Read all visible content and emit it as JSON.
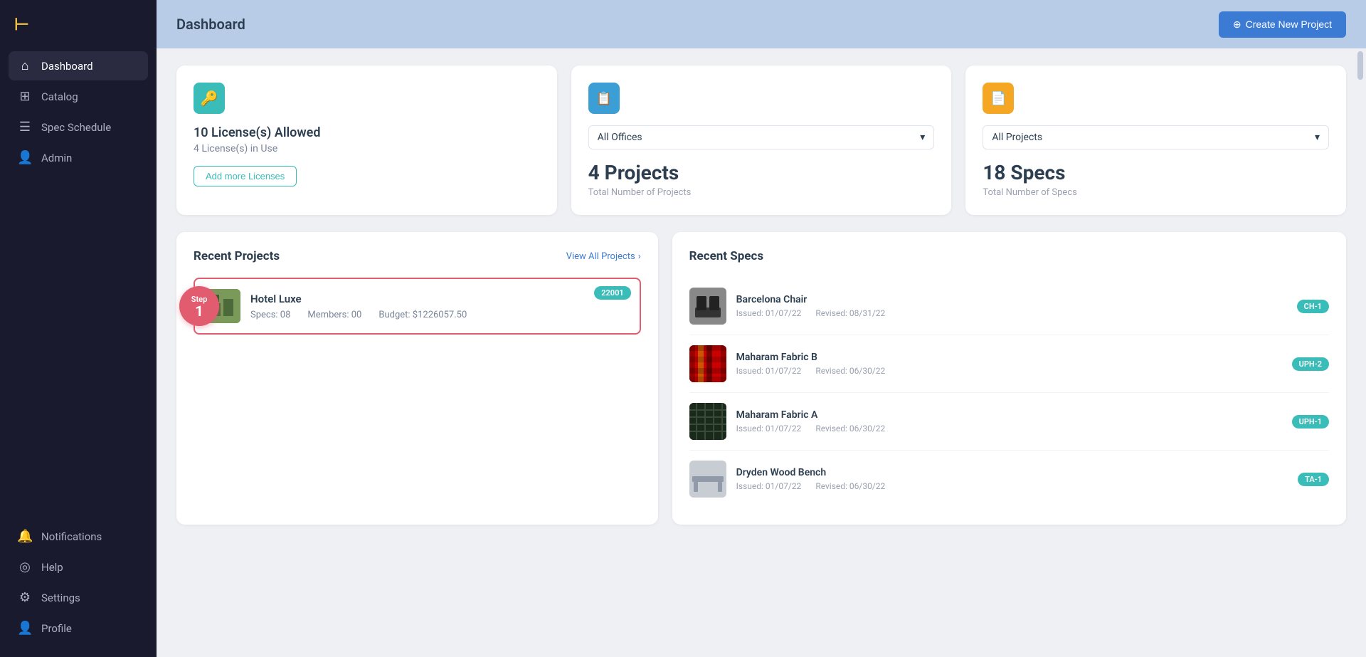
{
  "app": {
    "logo": "⊢",
    "logo_color": "#f0c040"
  },
  "sidebar": {
    "nav_items": [
      {
        "id": "dashboard",
        "label": "Dashboard",
        "icon": "⌂",
        "active": true
      },
      {
        "id": "catalog",
        "label": "Catalog",
        "icon": "⊞",
        "active": false
      },
      {
        "id": "spec-schedule",
        "label": "Spec Schedule",
        "icon": "☰",
        "active": false
      },
      {
        "id": "admin",
        "label": "Admin",
        "icon": "👤",
        "active": false
      }
    ],
    "bottom_items": [
      {
        "id": "notifications",
        "label": "Notifications",
        "icon": "🔔"
      },
      {
        "id": "help",
        "label": "Help",
        "icon": "◎"
      },
      {
        "id": "settings",
        "label": "Settings",
        "icon": "⚙"
      },
      {
        "id": "profile",
        "label": "Profile",
        "icon": "👤"
      }
    ]
  },
  "header": {
    "title": "Dashboard",
    "create_button_label": "Create New Project",
    "create_button_icon": "⊕"
  },
  "stats": {
    "licenses": {
      "icon": "🔑",
      "licenses_allowed_label": "10 License(s) Allowed",
      "licenses_in_use_label": "4 License(s) in Use",
      "add_button_label": "Add more Licenses"
    },
    "projects": {
      "icon": "📋",
      "dropdown_label": "All Offices",
      "dropdown_icon": "▾",
      "count": "4 Projects",
      "count_label": "Total Number of Projects"
    },
    "specs": {
      "icon": "📄",
      "dropdown_label": "All Projects",
      "dropdown_icon": "▾",
      "count": "18 Specs",
      "count_label": "Total Number of Specs"
    }
  },
  "recent_projects": {
    "title": "Recent Projects",
    "view_all_label": "View All Projects",
    "view_all_icon": "›",
    "step_label": "Step",
    "step_number": "1",
    "items": [
      {
        "id": "hotel-luxe",
        "name": "Hotel Luxe",
        "specs": "Specs: 08",
        "members": "Members: 00",
        "budget": "Budget: $1226057.50",
        "badge": "22001",
        "thumb_color": "#7a9a5a"
      }
    ]
  },
  "recent_specs": {
    "title": "Recent Specs",
    "items": [
      {
        "id": "barcelona-chair",
        "name": "Barcelona Chair",
        "issued": "Issued: 01/07/22",
        "revised": "Revised: 08/31/22",
        "badge": "CH-1",
        "thumb": "barcelona"
      },
      {
        "id": "maharam-fabric-b",
        "name": "Maharam Fabric B",
        "issued": "Issued: 01/07/22",
        "revised": "Revised: 06/30/22",
        "badge": "UPH-2",
        "thumb": "maharam-b"
      },
      {
        "id": "maharam-fabric-a",
        "name": "Maharam Fabric A",
        "issued": "Issued: 01/07/22",
        "revised": "Revised: 06/30/22",
        "badge": "UPH-1",
        "thumb": "maharam-a"
      },
      {
        "id": "dryden-wood-bench",
        "name": "Dryden Wood Bench",
        "issued": "Issued: 01/07/22",
        "revised": "Revised: 06/30/22",
        "badge": "TA-1",
        "thumb": "dryden"
      }
    ]
  }
}
